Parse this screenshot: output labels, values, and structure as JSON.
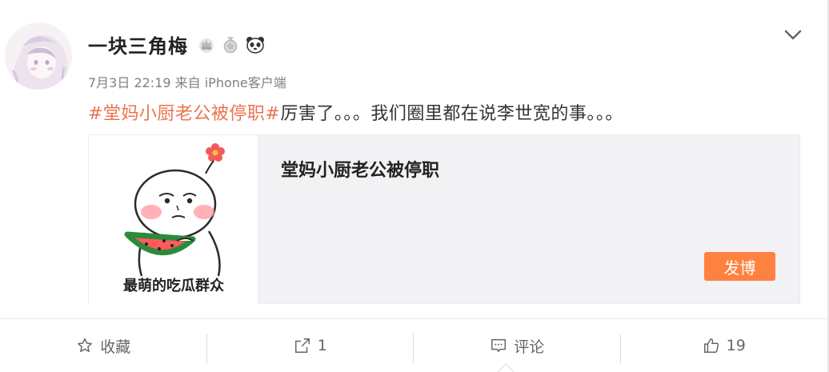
{
  "post": {
    "username": "一块三角梅",
    "badges": [
      "vip-crown-icon",
      "medal-icon",
      "panda-icon"
    ],
    "meta": "7月3日 22:19 来自 iPhone客户端",
    "topic": "#堂妈小厨老公被停职#",
    "text": "厉害了。。。我们圈里都在说李世宽的事。。。"
  },
  "card": {
    "image_caption": "最萌的吃瓜群众",
    "title": "堂妈小厨老公被停职",
    "post_button": "发博"
  },
  "actions": {
    "favorite": "收藏",
    "repost": "1",
    "comment": "评论",
    "like": "19"
  },
  "colors": {
    "topic": "#eb7350",
    "post_button": "#ff8140",
    "card_bg": "#f2f2f5"
  }
}
